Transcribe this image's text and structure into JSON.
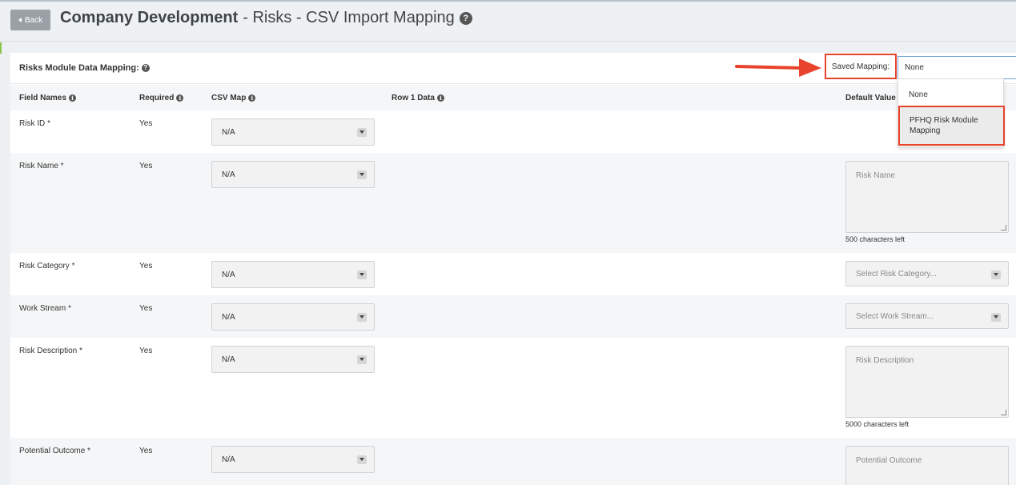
{
  "header": {
    "back_label": "Back",
    "title_bold": "Company Development",
    "title_rest": "- Risks - CSV Import Mapping"
  },
  "panel": {
    "title": "Risks Module Data Mapping:",
    "saved_mapping_label": "Saved Mapping:",
    "saved_mapping_value": "None",
    "dropdown_options": [
      "None",
      "PFHQ Risk Module Mapping"
    ]
  },
  "columns": {
    "field_names": "Field Names",
    "required": "Required",
    "csv_map": "CSV Map",
    "row1": "Row 1 Data",
    "default_value": "Default Value"
  },
  "rows": [
    {
      "field": "Risk ID *",
      "required": "Yes",
      "csv": "N/A"
    },
    {
      "field": "Risk Name *",
      "required": "Yes",
      "csv": "N/A",
      "default_placeholder": "Risk Name",
      "chars_left": "500 characters left"
    },
    {
      "field": "Risk Category *",
      "required": "Yes",
      "csv": "N/A",
      "default_placeholder": "Select Risk Category..."
    },
    {
      "field": "Work Stream *",
      "required": "Yes",
      "csv": "N/A",
      "default_placeholder": "Select Work Stream..."
    },
    {
      "field": "Risk Description *",
      "required": "Yes",
      "csv": "N/A",
      "default_placeholder": "Risk Description",
      "chars_left": "5000 characters left"
    },
    {
      "field": "Potential Outcome *",
      "required": "Yes",
      "csv": "N/A",
      "default_placeholder": "Potential Outcome"
    }
  ],
  "colors": {
    "highlight": "#e8432c",
    "select_border": "#6fa5d6",
    "back_button": "#9aa0a6"
  }
}
